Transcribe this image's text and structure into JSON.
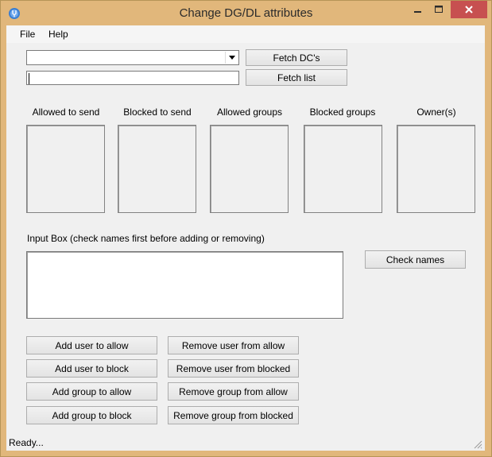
{
  "window": {
    "title": "Change DG/DL attributes",
    "app_icon": "app-icon",
    "controls": [
      "minimize-icon",
      "maximize-icon",
      "close-icon"
    ],
    "close_color": "#c75050",
    "frame_color": "#e1b77b"
  },
  "menu": {
    "items": [
      {
        "label": "File"
      },
      {
        "label": "Help"
      }
    ]
  },
  "top": {
    "dc_combo_value": "",
    "list_input_value": "",
    "fetch_dcs_label": "Fetch DC's",
    "fetch_list_label": "Fetch list"
  },
  "columns": [
    {
      "label": "Allowed to send"
    },
    {
      "label": "Blocked to send"
    },
    {
      "label": "Allowed groups"
    },
    {
      "label": "Blocked groups"
    },
    {
      "label": "Owner(s)"
    }
  ],
  "input_box": {
    "label": "Input Box (check names first before adding or removing)",
    "value": "",
    "check_names_label": "Check names"
  },
  "actions": {
    "add_user_allow": "Add user to allow",
    "add_user_block": "Add user to block",
    "add_group_allow": "Add group to allow",
    "add_group_block": "Add group to block",
    "remove_user_allow": "Remove user from allow",
    "remove_user_blocked": "Remove user from blocked",
    "remove_group_allow": "Remove group from allow",
    "remove_group_blocked": "Remove group from blocked"
  },
  "status": {
    "text": "Ready..."
  }
}
